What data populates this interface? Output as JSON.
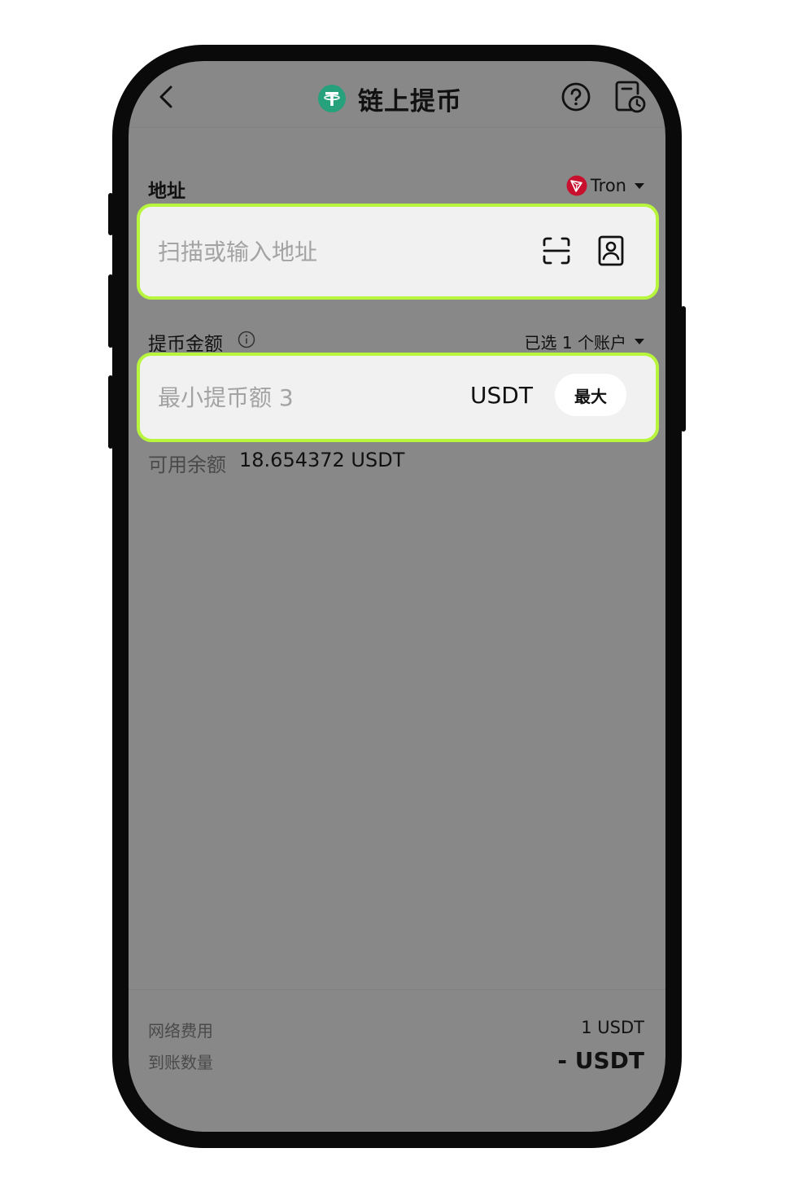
{
  "header": {
    "title": "链上提币",
    "back_icon": "chevron-left-icon",
    "coin_icon": "tether-icon",
    "help_icon": "question-circle-icon",
    "history_icon": "history-record-icon"
  },
  "address": {
    "label": "地址",
    "network": "Tron",
    "placeholder": "扫描或输入地址",
    "value": ""
  },
  "amount": {
    "label": "提币金额",
    "accounts_selected": "已选 1 个账户",
    "placeholder": "最小提币额 3",
    "value": "",
    "currency": "USDT",
    "max_label": "最大"
  },
  "balance": {
    "label": "可用余额",
    "value": "18.654372 USDT"
  },
  "footer": {
    "fee_label": "网络费用",
    "fee_value": "1 USDT",
    "receive_label": "到账数量",
    "receive_value": "- USDT"
  },
  "colors": {
    "highlight": "#b7f63c",
    "tether": "#26a17b",
    "tron": "#c8102e",
    "overlay": "#888888"
  }
}
